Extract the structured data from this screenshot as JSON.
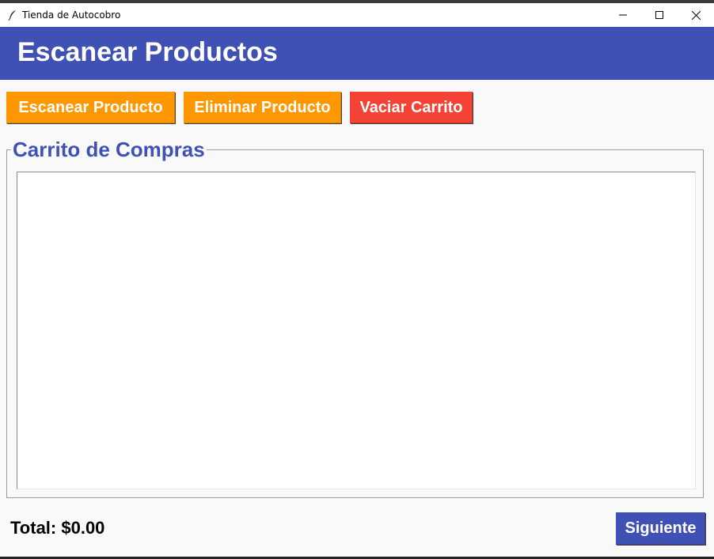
{
  "window": {
    "title": "Tienda de Autocobro",
    "icon": "feather-icon",
    "controls": [
      "minimize-icon",
      "maximize-icon",
      "close-icon"
    ]
  },
  "header": {
    "title": "Escanear Productos",
    "background": "#3f51b5"
  },
  "toolbar": {
    "scan_label": "Escanear Producto",
    "remove_label": "Eliminar Producto",
    "clear_label": "Vaciar Carrito"
  },
  "cart": {
    "legend": "Carrito de Compras",
    "items": []
  },
  "footer": {
    "total_label": "Total: $0.00",
    "next_label": "Siguiente"
  },
  "colors": {
    "primary": "#3f51b5",
    "orange": "#ff9800",
    "red": "#f44336",
    "background": "#f9f9f9"
  }
}
